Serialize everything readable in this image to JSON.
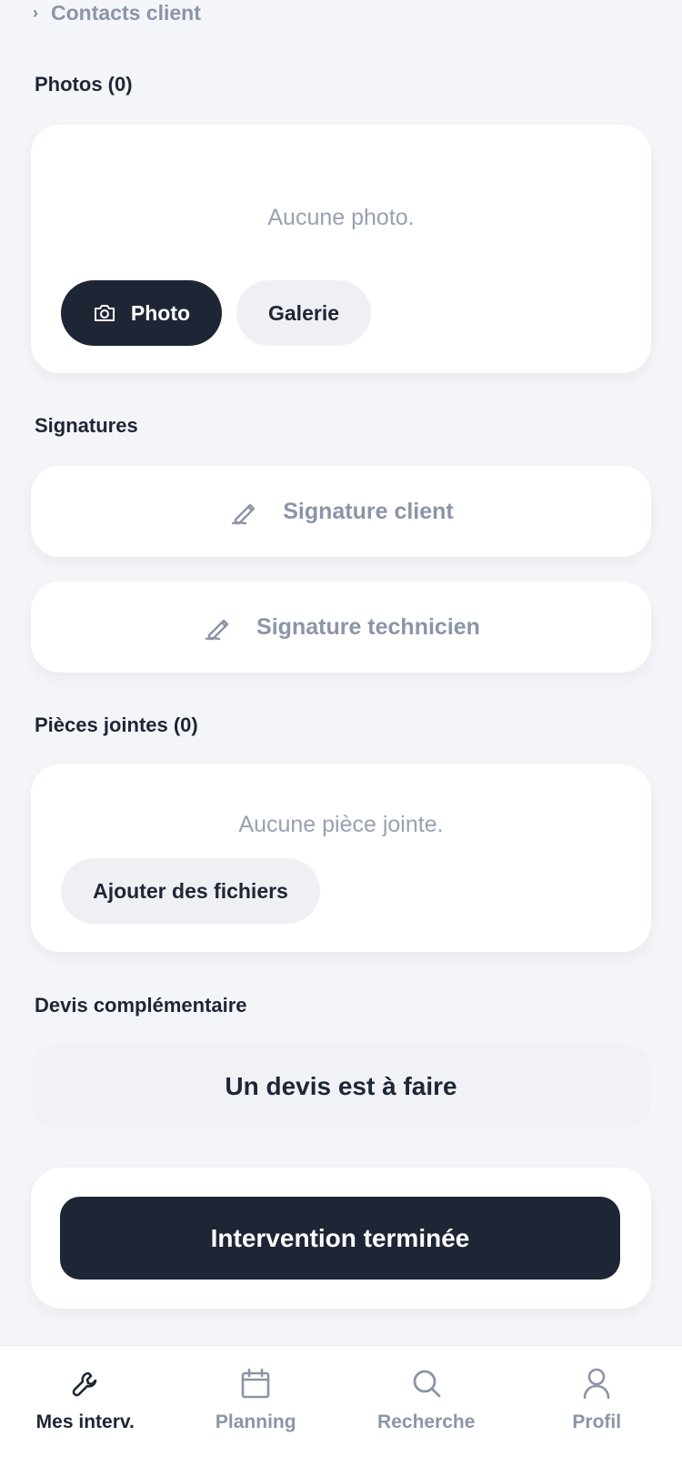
{
  "contacts": {
    "label": "Contacts client",
    "icon": "chevron-right-icon"
  },
  "photos": {
    "title": "Photos (0)",
    "empty_text": "Aucune photo.",
    "photo_button": "Photo",
    "photo_icon": "camera-icon",
    "gallery_button": "Galerie"
  },
  "signatures": {
    "title": "Signatures",
    "client_label": "Signature client",
    "technician_label": "Signature technicien",
    "icon": "pen-icon"
  },
  "attachments": {
    "title": "Pièces jointes (0)",
    "empty_text": "Aucune pièce jointe.",
    "add_button": "Ajouter des fichiers"
  },
  "devis": {
    "title": "Devis complémentaire",
    "status_text": "Un devis est à faire"
  },
  "finish": {
    "button_label": "Intervention terminée"
  },
  "nav": {
    "items": [
      {
        "label": "Mes interv.",
        "icon": "wrench-icon",
        "active": true
      },
      {
        "label": "Planning",
        "icon": "calendar-icon",
        "active": false
      },
      {
        "label": "Recherche",
        "icon": "search-icon",
        "active": false
      },
      {
        "label": "Profil",
        "icon": "user-icon",
        "active": false
      }
    ]
  },
  "colors": {
    "background": "#f3f5f8",
    "primary": "#1e2535",
    "muted": "#8b95a7",
    "card": "#ffffff",
    "pill_light": "#eef0f4"
  }
}
